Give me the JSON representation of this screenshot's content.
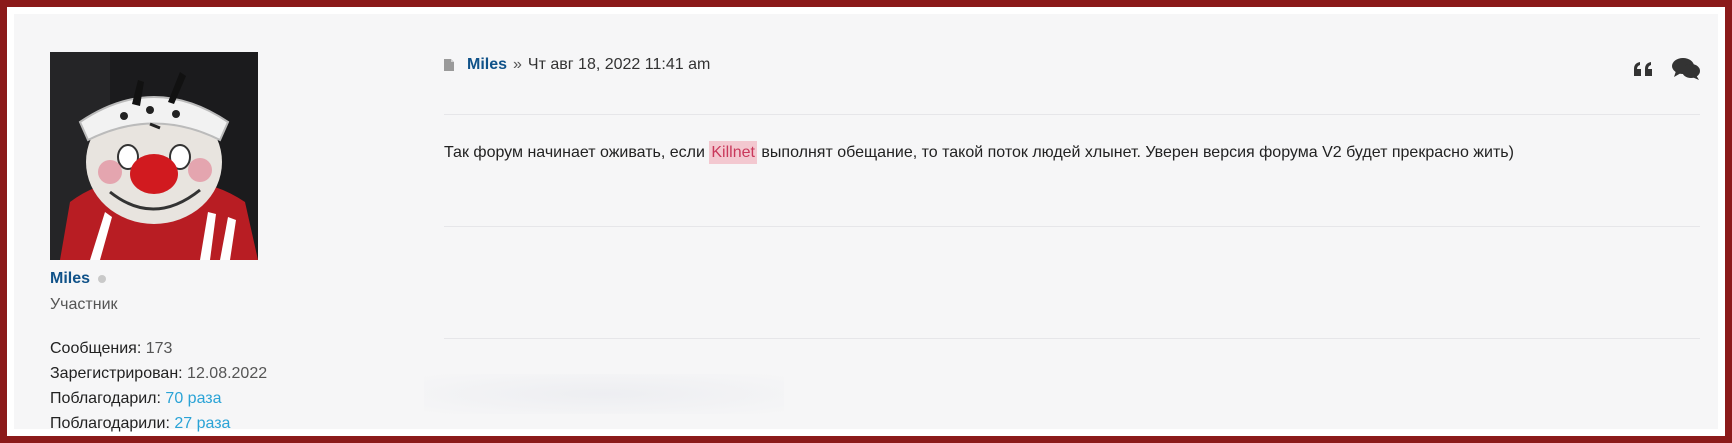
{
  "post": {
    "author": "Miles",
    "separator": "»",
    "datetime": "Чт авг 18, 2022 11:41 am",
    "content_before": "Так форум начинает оживать, если ",
    "content_highlight": "Killnet",
    "content_after": " выполнят обещание, то такой поток людей хлынет. Уверен версия форума V2 будет прекрасно жить)",
    "actions": {
      "quote_icon": "quote-icon",
      "reply_icon": "comments-icon"
    }
  },
  "profile": {
    "username": "Miles",
    "rank": "Участник",
    "stats": {
      "posts_label": "Сообщения:",
      "posts_value": "173",
      "registered_label": "Зарегистрирован:",
      "registered_value": "12.08.2022",
      "thanked_label": "Поблагодарил:",
      "thanked_value": "70 раза",
      "thanked_by_label": "Поблагодарили:",
      "thanked_by_value": "27 раза"
    }
  },
  "colors": {
    "frame": "#8b1a1a",
    "username": "#105289",
    "link": "#2aa3d6",
    "highlight_bg": "#f3c8d0",
    "highlight_text": "#c9385b"
  }
}
